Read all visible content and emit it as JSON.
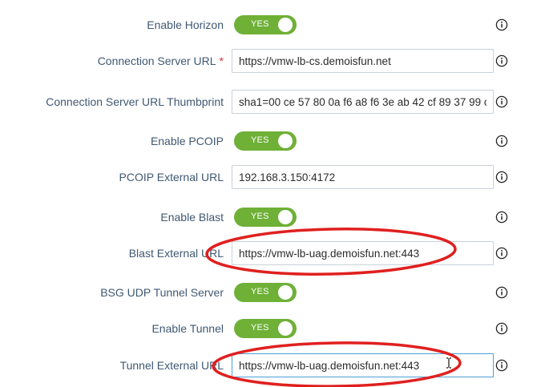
{
  "form": {
    "enable_horizon": {
      "label": "Enable Horizon",
      "toggle": "YES"
    },
    "connection_server_url": {
      "label": "Connection Server URL",
      "required_mark": "*",
      "value": "https://vmw-lb-cs.demoisfun.net"
    },
    "connection_server_thumbprint": {
      "label": "Connection Server URL Thumbprint",
      "value": "sha1=00 ce 57 80 0a f6 a8 f6 3e ab 42 cf 89 37 99 c"
    },
    "enable_pcoip": {
      "label": "Enable PCOIP",
      "toggle": "YES"
    },
    "pcoip_external_url": {
      "label": "PCOIP External URL",
      "value": "192.168.3.150:4172"
    },
    "enable_blast": {
      "label": "Enable Blast",
      "toggle": "YES"
    },
    "blast_external_url": {
      "label": "Blast External URL",
      "value": "https://vmw-lb-uag.demoisfun.net:443"
    },
    "bsg_udp_tunnel_server": {
      "label": "BSG UDP Tunnel Server",
      "toggle": "YES"
    },
    "enable_tunnel": {
      "label": "Enable Tunnel",
      "toggle": "YES"
    },
    "tunnel_external_url": {
      "label": "Tunnel External URL",
      "value": "https://vmw-lb-uag.demoisfun.net:443"
    }
  },
  "colors": {
    "label_text": "#3f5873",
    "toggle_on": "#6fb037",
    "required": "#d9313a",
    "annotation_oval": "#e0201f",
    "field_border": "#c9d1d9",
    "field_focus_border": "#4aa0d8"
  },
  "icons": {
    "info": "info-icon",
    "annotation": "red-oval-highlight",
    "cursor": "text-cursor-icon"
  }
}
